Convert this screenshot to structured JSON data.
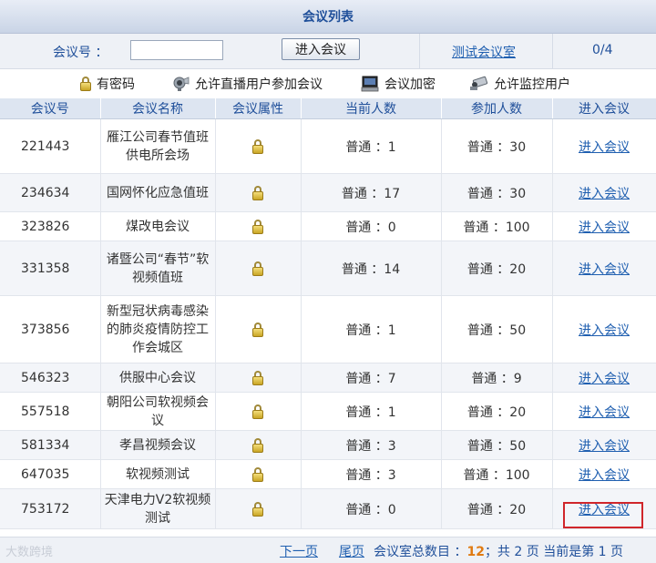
{
  "title": "会议列表",
  "search": {
    "label": "会议号 ：",
    "input_value": "",
    "enter_button": "进入会议",
    "test_room": "测试会议室",
    "room_count": "0/4"
  },
  "legend": [
    {
      "icon": "lock-icon",
      "label": "有密码"
    },
    {
      "icon": "camera-icon",
      "label": "允许直播用户参加会议"
    },
    {
      "icon": "computer-icon",
      "label": "会议加密"
    },
    {
      "icon": "monitor-camera-icon",
      "label": "允许监控用户"
    }
  ],
  "columns": [
    "会议号",
    "会议名称",
    "会议属性",
    "当前人数",
    "参加人数",
    "进入会议"
  ],
  "rows": [
    {
      "id": "221443",
      "name": "雁江公司春节值班供电所会场",
      "current": "普通 ：1",
      "joined": "普通 ：30",
      "enter": "进入会议"
    },
    {
      "id": "234634",
      "name": "国网怀化应急值班",
      "current": "普通 ：17",
      "joined": "普通 ：30",
      "enter": "进入会议"
    },
    {
      "id": "323826",
      "name": "煤改电会议",
      "current": "普通 ：0",
      "joined": "普通 ：100",
      "enter": "进入会议"
    },
    {
      "id": "331358",
      "name": "诸暨公司“春节”软视频值班",
      "current": "普通 ：14",
      "joined": "普通 ：20",
      "enter": "进入会议"
    },
    {
      "id": "373856",
      "name": "新型冠状病毒感染的肺炎疫情防控工作会城区",
      "current": "普通 ：1",
      "joined": "普通 ：50",
      "enter": "进入会议"
    },
    {
      "id": "546323",
      "name": "供服中心会议",
      "current": "普通 ：7",
      "joined": "普通 ：9",
      "enter": "进入会议"
    },
    {
      "id": "557518",
      "name": "朝阳公司软视频会议",
      "current": "普通 ：1",
      "joined": "普通 ：20",
      "enter": "进入会议"
    },
    {
      "id": "581334",
      "name": "孝昌视频会议",
      "current": "普通 ：3",
      "joined": "普通 ：50",
      "enter": "进入会议"
    },
    {
      "id": "647035",
      "name": "软视频测试",
      "current": "普通 ：3",
      "joined": "普通 ：100",
      "enter": "进入会议"
    },
    {
      "id": "753172",
      "name": "天津电力V2软视频测试",
      "current": "普通 ：0",
      "joined": "普通 ：20",
      "enter": "进入会议"
    }
  ],
  "footer": {
    "watermark": "大数跨境",
    "next_page": "下一页",
    "last_page": "尾页",
    "total_label": "会议室总数目 ：",
    "total": "12",
    "pages_text": "；共 2 页 当前是第 1 页"
  },
  "colors": {
    "header_blue": "#1f4f9a",
    "link_blue": "#1f5fb0",
    "highlight_red": "#d0262b",
    "total_orange": "#e07a10"
  }
}
